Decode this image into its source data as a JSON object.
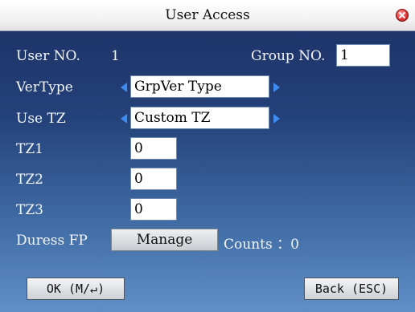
{
  "window": {
    "title": "User Access"
  },
  "fields": {
    "user_no_label": "User NO.",
    "user_no_value": "1",
    "group_no_label": "Group NO.",
    "group_no_value": "1",
    "vertype_label": "VerType",
    "vertype_value": "GrpVer Type",
    "use_tz_label": "Use TZ",
    "use_tz_value": "Custom TZ",
    "tz1_label": "TZ1",
    "tz1_value": "0",
    "tz2_label": "TZ2",
    "tz2_value": "0",
    "tz3_label": "TZ3",
    "tz3_value": "0",
    "duress_label": "Duress FP",
    "manage_label": "Manage",
    "counts_label": "Counts ：0"
  },
  "buttons": {
    "ok_label": "OK (M/↵)",
    "back_label": "Back (ESC)"
  },
  "icons": {
    "close": "close-icon",
    "left": "left-arrow-icon",
    "right": "right-arrow-icon"
  },
  "colors": {
    "accent": "#3f8cf0",
    "close": "#e03a3a"
  }
}
